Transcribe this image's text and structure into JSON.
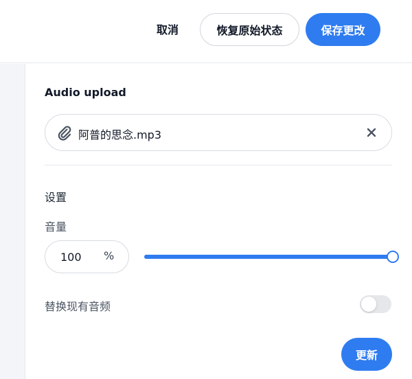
{
  "header": {
    "cancel_label": "取消",
    "restore_label": "恢复原始状态",
    "save_label": "保存更改"
  },
  "upload": {
    "title": "Audio upload",
    "file_name": "阿普的思念.mp3",
    "file_icon": "paperclip-icon",
    "clear_icon": "close-icon"
  },
  "settings": {
    "title": "设置",
    "volume": {
      "label": "音量",
      "value": "100",
      "unit": "%",
      "slider_fraction": 1.0
    },
    "replace_audio": {
      "label": "替换现有音频",
      "enabled": false
    },
    "update_label": "更新"
  },
  "colors": {
    "accent": "#2f7cf0",
    "border": "#d7dbe0",
    "gutter": "#f3f5f9"
  }
}
